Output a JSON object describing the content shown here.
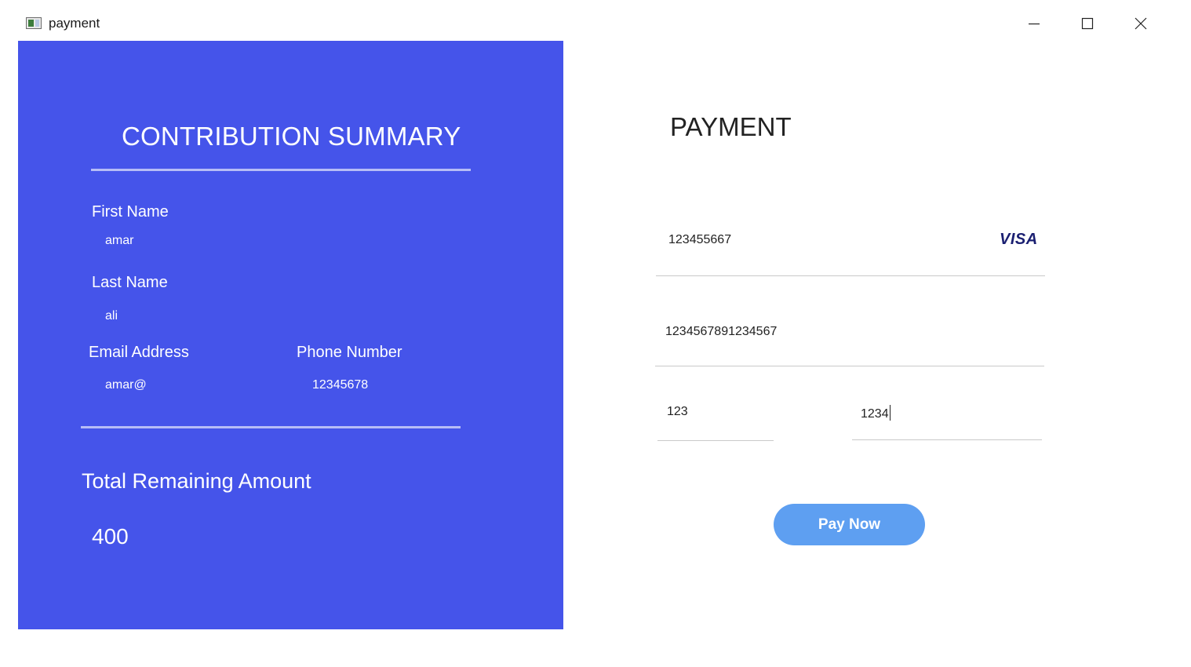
{
  "window": {
    "title": "payment"
  },
  "summary": {
    "title": "CONTRIBUTION SUMMARY",
    "first_name_label": "First Name",
    "first_name_value": "amar",
    "last_name_label": "Last Name",
    "last_name_value": "ali",
    "email_label": "Email Address",
    "email_value": "amar@",
    "phone_label": "Phone Number",
    "phone_value": "12345678",
    "total_label": "Total Remaining Amount",
    "total_value": "400",
    "panel_color": "#4554ea"
  },
  "payment": {
    "title": "PAYMENT",
    "card_number": "123455667",
    "card_brand": "VISA",
    "second_field": "1234567891234567",
    "third_field": "123",
    "fourth_field": "1234",
    "pay_button_label": "Pay Now",
    "button_color": "#5e9ff1"
  },
  "icons": {
    "app": "app-window-icon",
    "minimize": "minimize-icon",
    "maximize": "maximize-icon",
    "close": "close-icon"
  }
}
